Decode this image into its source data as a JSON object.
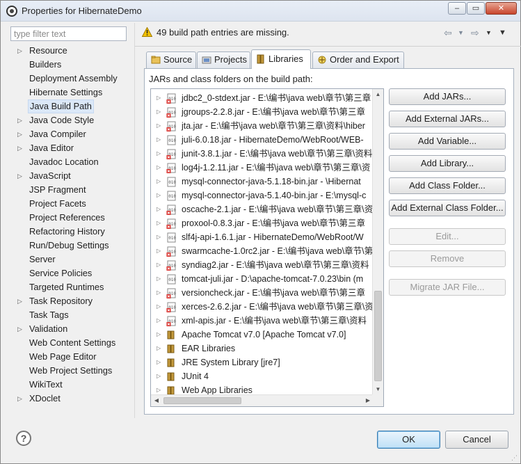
{
  "window": {
    "title": "Properties for HibernateDemo",
    "min": "‒",
    "max": "▭",
    "close": "✕"
  },
  "filter": {
    "placeholder": "type filter text"
  },
  "tree": [
    {
      "label": "Resource",
      "arrow": true
    },
    {
      "label": "Builders",
      "arrow": false
    },
    {
      "label": "Deployment Assembly",
      "arrow": false
    },
    {
      "label": "Hibernate Settings",
      "arrow": false
    },
    {
      "label": "Java Build Path",
      "arrow": false,
      "selected": true
    },
    {
      "label": "Java Code Style",
      "arrow": true
    },
    {
      "label": "Java Compiler",
      "arrow": true
    },
    {
      "label": "Java Editor",
      "arrow": true
    },
    {
      "label": "Javadoc Location",
      "arrow": false
    },
    {
      "label": "JavaScript",
      "arrow": true
    },
    {
      "label": "JSP Fragment",
      "arrow": false
    },
    {
      "label": "Project Facets",
      "arrow": false
    },
    {
      "label": "Project References",
      "arrow": false
    },
    {
      "label": "Refactoring History",
      "arrow": false
    },
    {
      "label": "Run/Debug Settings",
      "arrow": false
    },
    {
      "label": "Server",
      "arrow": false
    },
    {
      "label": "Service Policies",
      "arrow": false
    },
    {
      "label": "Targeted Runtimes",
      "arrow": false
    },
    {
      "label": "Task Repository",
      "arrow": true
    },
    {
      "label": "Task Tags",
      "arrow": false
    },
    {
      "label": "Validation",
      "arrow": true
    },
    {
      "label": "Web Content Settings",
      "arrow": false
    },
    {
      "label": "Web Page Editor",
      "arrow": false
    },
    {
      "label": "Web Project Settings",
      "arrow": false
    },
    {
      "label": "WikiText",
      "arrow": false
    },
    {
      "label": "XDoclet",
      "arrow": true
    }
  ],
  "header": {
    "warning": "49 build path entries are missing."
  },
  "tabs": [
    {
      "label": "Source"
    },
    {
      "label": "Projects"
    },
    {
      "label": "Libraries",
      "active": true
    },
    {
      "label": "Order and Export"
    }
  ],
  "panel": {
    "label": "JARs and class folders on the build path:"
  },
  "entries": [
    {
      "text": "jdbc2_0-stdext.jar - E:\\编书\\java web\\章节\\第三章",
      "type": "missing"
    },
    {
      "text": "jgroups-2.2.8.jar - E:\\编书\\java web\\章节\\第三章",
      "type": "missing"
    },
    {
      "text": "jta.jar - E:\\编书\\java web\\章节\\第三章\\资料\\hiber",
      "type": "missing"
    },
    {
      "text": "juli-6.0.18.jar - HibernateDemo/WebRoot/WEB-",
      "type": "jar"
    },
    {
      "text": "junit-3.8.1.jar - E:\\编书\\java web\\章节\\第三章\\资料",
      "type": "missing"
    },
    {
      "text": "log4j-1.2.11.jar - E:\\编书\\java web\\章节\\第三章\\资",
      "type": "missing"
    },
    {
      "text": "mysql-connector-java-5.1.18-bin.jar - \\Hibernat",
      "type": "jar"
    },
    {
      "text": "mysql-connector-java-5.1.40-bin.jar - E:\\mysql-c",
      "type": "jar"
    },
    {
      "text": "oscache-2.1.jar - E:\\编书\\java web\\章节\\第三章\\资",
      "type": "missing"
    },
    {
      "text": "proxool-0.8.3.jar - E:\\编书\\java web\\章节\\第三章",
      "type": "missing"
    },
    {
      "text": "slf4j-api-1.6.1.jar - HibernateDemo/WebRoot/W",
      "type": "jar"
    },
    {
      "text": "swarmcache-1.0rc2.jar - E:\\编书\\java web\\章节\\第",
      "type": "missing"
    },
    {
      "text": "syndiag2.jar - E:\\编书\\java web\\章节\\第三章\\资料",
      "type": "missing"
    },
    {
      "text": "tomcat-juli.jar - D:\\apache-tomcat-7.0.23\\bin (m",
      "type": "jar"
    },
    {
      "text": "versioncheck.jar - E:\\编书\\java web\\章节\\第三章",
      "type": "missing"
    },
    {
      "text": "xerces-2.6.2.jar - E:\\编书\\java web\\章节\\第三章\\资",
      "type": "missing"
    },
    {
      "text": "xml-apis.jar - E:\\编书\\java web\\章节\\第三章\\资料",
      "type": "missing"
    },
    {
      "text": "Apache Tomcat v7.0 [Apache Tomcat v7.0]",
      "type": "lib"
    },
    {
      "text": "EAR Libraries",
      "type": "lib"
    },
    {
      "text": "JRE System Library [jre7]",
      "type": "lib"
    },
    {
      "text": "JUnit 4",
      "type": "lib"
    },
    {
      "text": "Web App Libraries",
      "type": "lib"
    }
  ],
  "buttons": {
    "add_jars": "Add JARs...",
    "add_external_jars": "Add External JARs...",
    "add_variable": "Add Variable...",
    "add_library": "Add Library...",
    "add_class_folder": "Add Class Folder...",
    "add_external_class_folder": "Add External Class Folder...",
    "edit": "Edit...",
    "remove": "Remove",
    "migrate_jar": "Migrate JAR File..."
  },
  "footer": {
    "help": "?",
    "ok": "OK",
    "cancel": "Cancel"
  },
  "colors": {
    "selection": "#dbe8f8",
    "warning": "#e8b400",
    "primary_border": "#3c7fb1"
  }
}
